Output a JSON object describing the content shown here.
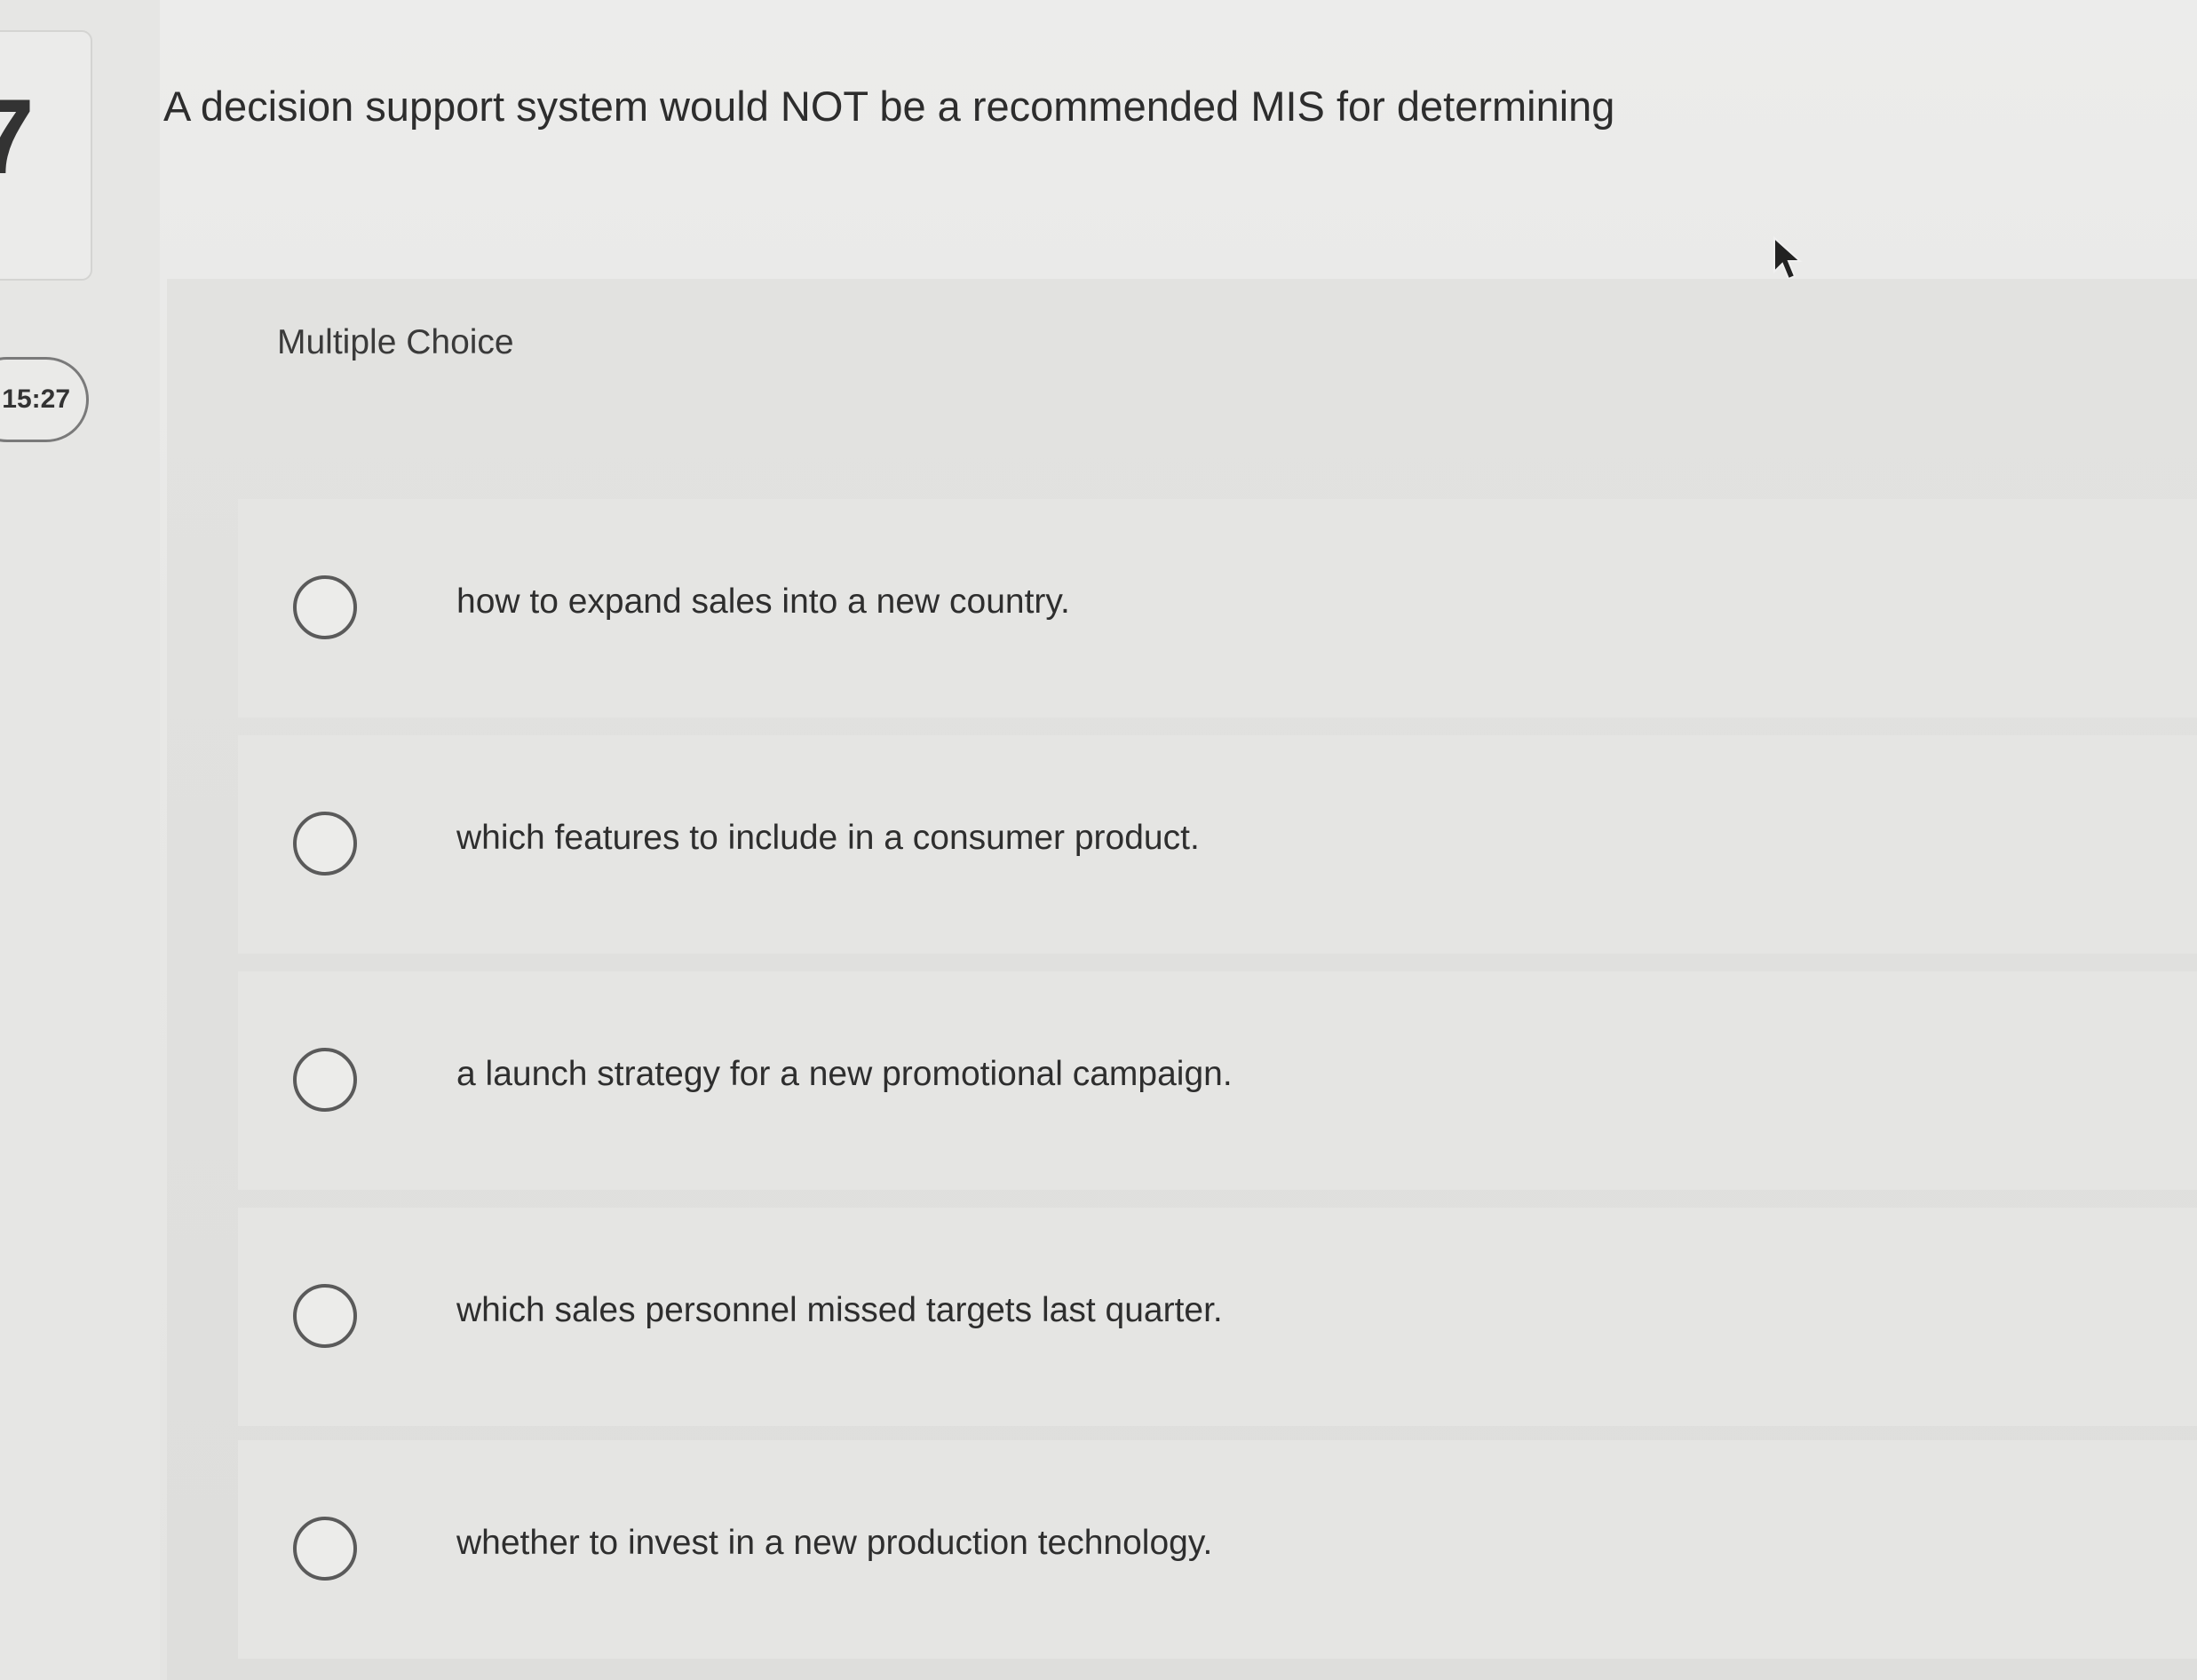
{
  "sidebar": {
    "question_number": "7",
    "timer": ":15:27"
  },
  "question": {
    "stem": "A decision support system would NOT be a recommended MIS for determining"
  },
  "answer_panel": {
    "title": "Multiple Choice",
    "options": [
      {
        "label": "how to expand sales into a new country.",
        "selected": false
      },
      {
        "label": "which features to include in a consumer product.",
        "selected": false
      },
      {
        "label": "a launch strategy for a new promotional campaign.",
        "selected": false
      },
      {
        "label": "which sales personnel missed targets last quarter.",
        "selected": false
      },
      {
        "label": "whether to invest in a new production technology.",
        "selected": false
      }
    ]
  },
  "icons": {
    "cursor": "mouse-pointer-icon",
    "radio": "radio-button-icon"
  },
  "colors": {
    "background": "#e8e8e6",
    "panel": "#e0e0de",
    "text": "#2c2c2c",
    "radio_border": "#5a5a5a"
  }
}
